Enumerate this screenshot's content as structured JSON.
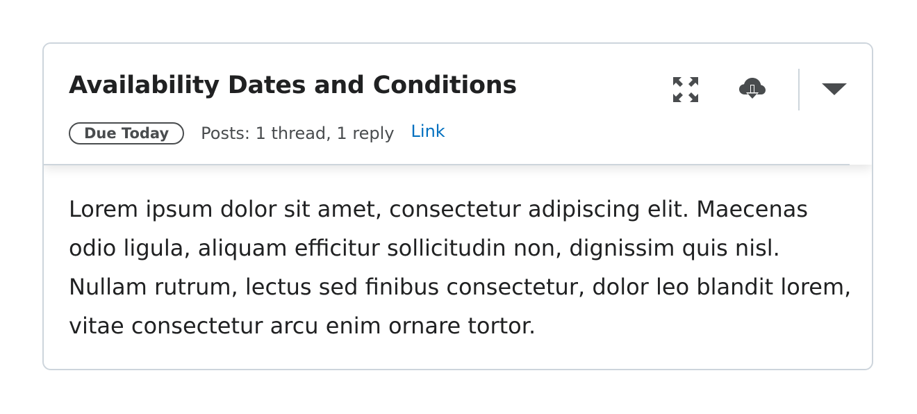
{
  "card": {
    "title": "Availability Dates and Conditions",
    "badge": "Due Today",
    "posts": "Posts: 1 thread, 1 reply",
    "link": "Link",
    "body": "Lorem ipsum dolor sit amet, consectetur adipiscing elit. Maecenas odio ligula, aliquam efficitur sollicitudin non, dignissim quis nisl. Nullam rutrum, lectus sed finibus consectetur, dolor leo blandit lorem, vitae consectetur arcu enim ornare tortor.",
    "actions": [
      {
        "icon": "expand-icon"
      },
      {
        "icon": "cloud-download-icon"
      },
      {
        "icon": "caret-down-icon"
      }
    ]
  },
  "colors": {
    "border": "#cdd5dc",
    "text": "#202122",
    "secondary_text": "#494c4e",
    "link": "#006fbf",
    "icon": "#494c4e"
  }
}
